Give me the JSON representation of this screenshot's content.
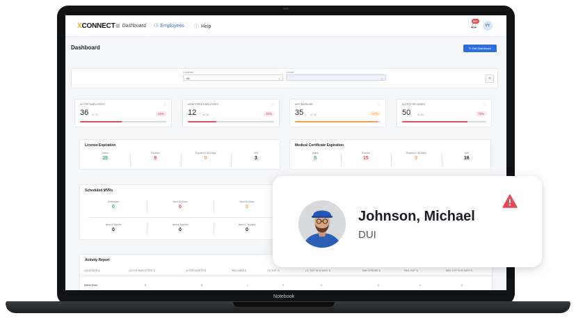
{
  "device": {
    "label": "Notebook"
  },
  "nav": {
    "logo_mark": "X",
    "logo_text": "CONNECT",
    "items": [
      {
        "label": "Dashboard",
        "icon": "grid-icon",
        "active": false
      },
      {
        "label": "Employees",
        "icon": "people-icon",
        "active": true
      },
      {
        "label": "Help",
        "icon": "help-circle-icon",
        "active": false
      }
    ],
    "notification_badge": "99+",
    "avatar_initials": "VY"
  },
  "page": {
    "title": "Dashboard",
    "edit_button": "Edit Dashboard"
  },
  "filters": {
    "locations_label": "Locations",
    "locations_value": "All",
    "groups_label": "Groups",
    "groups_value": ""
  },
  "kpis": [
    {
      "label": "ACTIVE EMPLOYEES",
      "value": "36",
      "of": "of 75",
      "percent": "48%",
      "fraction": 0.48,
      "color": "#e14b6b",
      "pill_bg": "#fde8ec"
    },
    {
      "label": "MONITORED EMPLOYEES",
      "value": "12",
      "of": "of 36",
      "percent": "33%",
      "fraction": 0.33,
      "color": "#e14b6b",
      "pill_bg": "#fde8ec"
    },
    {
      "label": "MVR BASELINE",
      "value": "35",
      "of": "of 36",
      "percent": "97%",
      "fraction": 0.97,
      "color": "#f2a04b",
      "pill_bg": "#fff1e0"
    },
    {
      "label": "ALERTS REVIEWED",
      "value": "50",
      "of": "of 64",
      "percent": "78%",
      "fraction": 0.78,
      "color": "#e14b6b",
      "pill_bg": "#fde8ec"
    }
  ],
  "license": {
    "title": "License Expiration",
    "stats": [
      {
        "label": "Active",
        "value": "25",
        "color": "green"
      },
      {
        "label": "Expired",
        "value": "8",
        "color": "red"
      },
      {
        "label": "Expires in 30 Days",
        "value": "0",
        "color": "orange"
      },
      {
        "label": "N/A",
        "value": "3",
        "color": "dark"
      }
    ]
  },
  "medical": {
    "title": "Medical Certificate Expiration",
    "stats": [
      {
        "label": "Active",
        "value": "5",
        "color": "green"
      },
      {
        "label": "Expired",
        "value": "15",
        "color": "red"
      },
      {
        "label": "Expires in 30 Days",
        "value": "0",
        "color": "orange"
      },
      {
        "label": "N/A",
        "value": "16",
        "color": "dark"
      }
    ]
  },
  "scheduled": {
    "title": "Scheduled MVRs",
    "row1": [
      {
        "label": "Scheduled",
        "value": "0",
        "color": "green"
      },
      {
        "label": "Next 30 Days",
        "value": "0",
        "color": "red"
      },
      {
        "label": "Next 60 Days",
        "value": "0",
        "color": "orange"
      }
    ],
    "row2": [
      {
        "label": "Next 3 Months",
        "value": "0",
        "color": "dark"
      },
      {
        "label": "Next 6 Months",
        "value": "0",
        "color": "dark"
      },
      {
        "label": "Next 12 Months",
        "value": "0",
        "color": "dark"
      }
    ]
  },
  "activity": {
    "title": "Activity Report",
    "columns": [
      "LOCATIONS ▲",
      "ACTIVE EMPLOYEES ⇅",
      "ACTIVE ALERTS ⇅",
      "INELIGIBLE ⇅",
      "LIC. EXP. ⇅",
      "LIC. EXP. IN 30 DAYS ⇅",
      "DMV ERRORS ⇅",
      "MED. EXP. ⇅",
      "MED. EXP. IN 30 DAYS ⇅"
    ],
    "row": [
      "North East",
      "5",
      "5",
      "1",
      "2",
      "0",
      "0",
      "4",
      "0"
    ]
  },
  "alert_card": {
    "name": "Johnson, Michael",
    "subtitle": "DUI",
    "icon": "warning-triangle-icon",
    "icon_color": "#e14b57"
  }
}
